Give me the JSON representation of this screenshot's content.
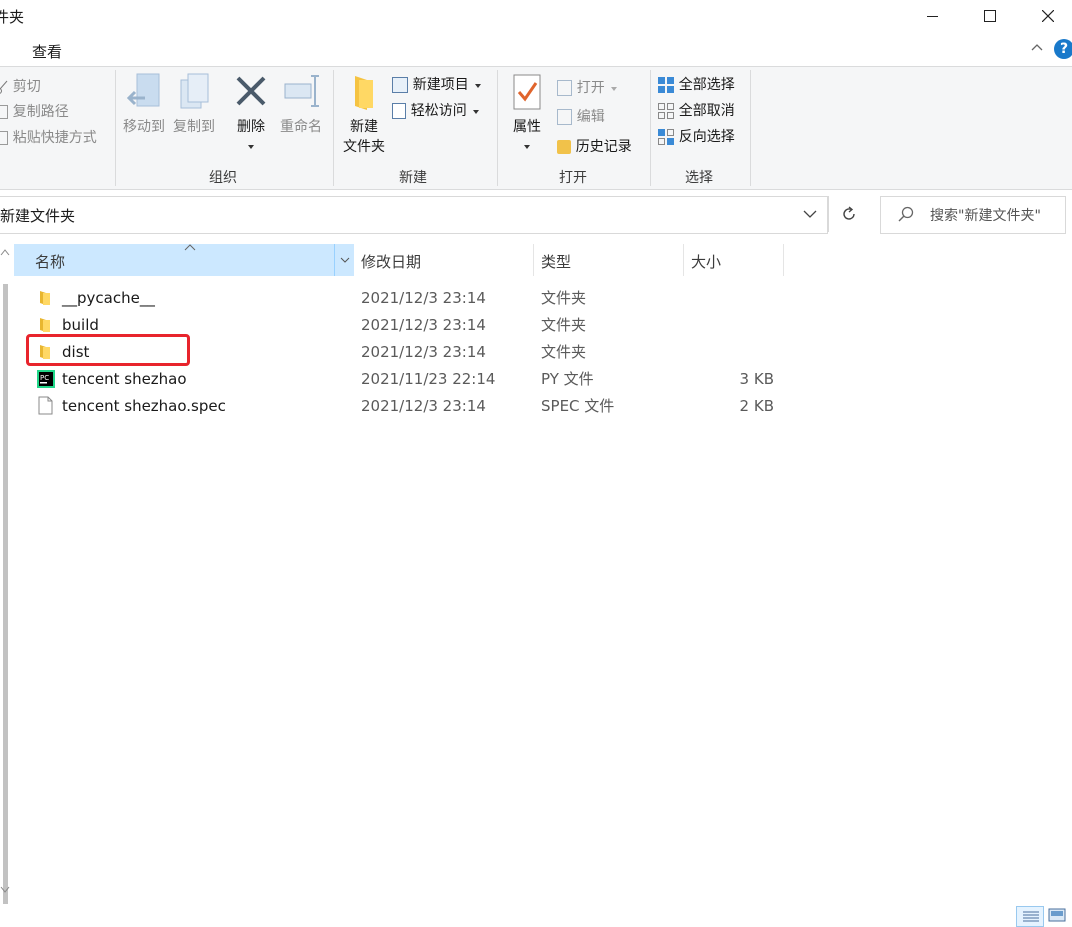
{
  "window": {
    "title": "件夹",
    "minimize_icon": "minimize-icon",
    "maximize_icon": "maximize-icon",
    "close_icon": "close-icon"
  },
  "ribbon_tabs": {
    "view": "查看",
    "help_icon": "help-icon"
  },
  "ribbon": {
    "clipboard": {
      "cut": "剪切",
      "copy_path": "复制路径",
      "paste_shortcut": "粘贴快捷方式"
    },
    "organize": {
      "move_to": "移动到",
      "copy_to": "复制到",
      "delete": "删除",
      "rename": "重命名",
      "label": "组织"
    },
    "new": {
      "new_folder_line1": "新建",
      "new_folder_line2": "文件夹",
      "new_item": "新建项目",
      "easy_access": "轻松访问",
      "label": "新建"
    },
    "open": {
      "properties": "属性",
      "open": "打开",
      "edit": "编辑",
      "history": "历史记录",
      "label": "打开"
    },
    "select": {
      "select_all": "全部选择",
      "select_none": "全部取消",
      "invert": "反向选择",
      "label": "选择"
    }
  },
  "address": {
    "path": "新建文件夹",
    "search_placeholder": "搜索\"新建文件夹\""
  },
  "columns": {
    "name": "名称",
    "modified": "修改日期",
    "type": "类型",
    "size": "大小"
  },
  "files": [
    {
      "name": "__pycache__",
      "modified": "2021/12/3 23:14",
      "type": "文件夹",
      "size": "",
      "icon": "folder-icon"
    },
    {
      "name": "build",
      "modified": "2021/12/3 23:14",
      "type": "文件夹",
      "size": "",
      "icon": "folder-icon"
    },
    {
      "name": "dist",
      "modified": "2021/12/3 23:14",
      "type": "文件夹",
      "size": "",
      "icon": "folder-icon"
    },
    {
      "name": "tencent shezhao",
      "modified": "2021/11/23 22:14",
      "type": "PY 文件",
      "size": "3 KB",
      "icon": "pycharm-file-icon"
    },
    {
      "name": "tencent shezhao.spec",
      "modified": "2021/12/3 23:14",
      "type": "SPEC 文件",
      "size": "2 KB",
      "icon": "file-icon"
    }
  ],
  "colors": {
    "highlight": "#e8242c",
    "header_bg": "#cce8ff",
    "accent": "#1979ca"
  }
}
